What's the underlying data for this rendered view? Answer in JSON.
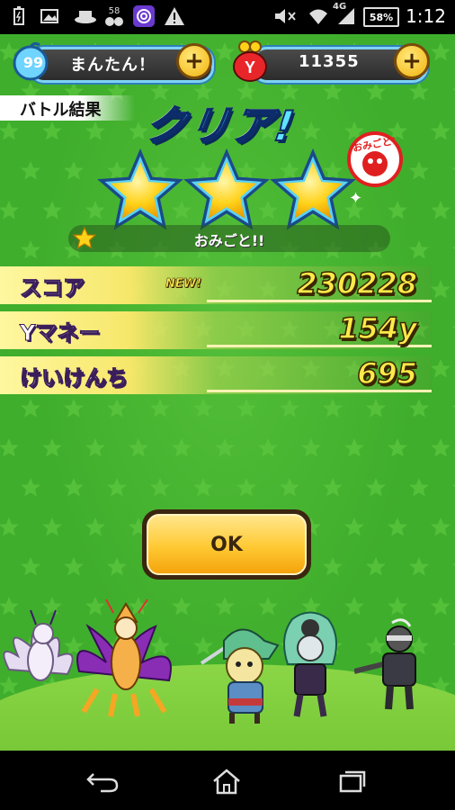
{
  "status_bar": {
    "battery_level_text": "58%",
    "network_badge": "4G",
    "notif_percent": "58",
    "time": "1:12",
    "icons": [
      "battery-saver-icon",
      "image-icon",
      "hat-icon",
      "notification-percent-icon",
      "app-swirl-icon",
      "warning-icon",
      "mute-icon",
      "wifi-icon",
      "signal-icon",
      "battery-icon"
    ]
  },
  "hud": {
    "level": "99",
    "stamina_label": "まんたん！",
    "money_value": "11355",
    "plus_symbol": "+",
    "money_icon": "y-money-purse-icon"
  },
  "result": {
    "section_label": "バトル結果",
    "title": "クリア!",
    "stars_earned": 3,
    "stars_total": 3,
    "evaluation_text": "おみごと!!",
    "seal_text": "おみごと!"
  },
  "stats": [
    {
      "label": "スコア",
      "value": "230228",
      "badge": "NEW!"
    },
    {
      "label": "Yマネー",
      "value": "154y",
      "badge": ""
    },
    {
      "label": "けいけんち",
      "value": "695",
      "badge": ""
    }
  ],
  "ok_button": {
    "label": "OK"
  },
  "party": [
    "pale-nine-tail-yokai",
    "orange-fox-yokai",
    "green-cat-samurai-yokai",
    "green-haired-yokai",
    "dark-armored-yokai"
  ],
  "nav": [
    "back-icon",
    "home-icon",
    "recent-apps-icon"
  ],
  "colors": {
    "background": "#3fae2c",
    "accent_yellow": "#ffe94a",
    "title_cyan": "#5fe3ff",
    "hud_border": "#7fd3f5"
  }
}
